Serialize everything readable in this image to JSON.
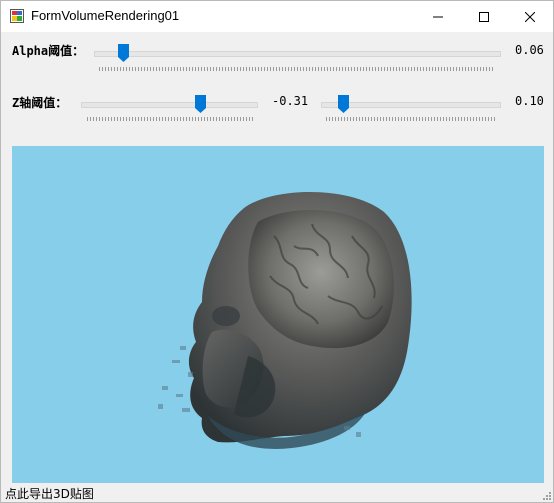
{
  "window": {
    "title": "FormVolumeRendering01"
  },
  "controls": {
    "alpha": {
      "label": "Alpha阈值：",
      "value_text": "0.06",
      "level": 0.06
    },
    "z_axis": {
      "label": "Z轴阈值：",
      "value_text": "-0.31",
      "level": 0.69
    },
    "z_axis_second": {
      "value_text": "0.10",
      "level": 0.1
    }
  },
  "viewport": {
    "background_color": "#87ceeb",
    "content": "volume-rendered-head"
  },
  "status_bar": {
    "text": "点此导出3D贴图"
  },
  "colors": {
    "slider_thumb": "#0078d7",
    "title_bar": "#ffffff",
    "window_bg": "#f0f0f0"
  },
  "icons": {
    "app": "app-icon",
    "minimize": "minimize-icon",
    "maximize": "maximize-icon",
    "close": "close-icon"
  }
}
